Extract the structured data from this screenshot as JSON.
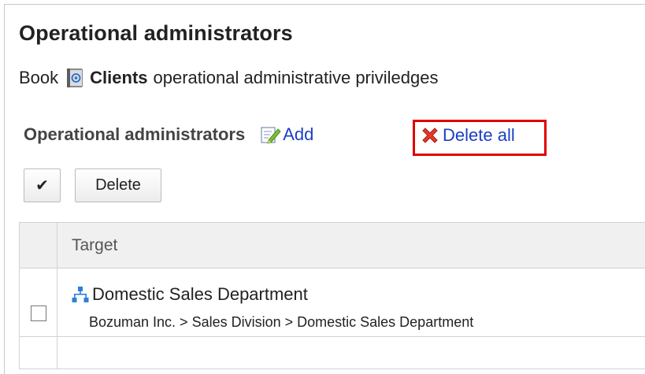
{
  "page": {
    "title": "Operational administrators",
    "subtitle_prefix": "Book",
    "subtitle_bold": "Clients",
    "subtitle_suffix": "operational administrative priviledges"
  },
  "section": {
    "title": "Operational administrators",
    "add_label": "Add",
    "delete_all_label": "Delete all"
  },
  "toolbar": {
    "check_label": "✔",
    "delete_label": "Delete"
  },
  "table": {
    "header_target": "Target",
    "rows": [
      {
        "name": "Domestic Sales Department",
        "path": "Bozuman Inc. > Sales Division > Domestic Sales Department"
      }
    ]
  },
  "colors": {
    "link": "#1a3fc4",
    "highlight": "#e00000",
    "header_bg": "#f0f0f0"
  },
  "icons": {
    "book": "book-icon",
    "add": "edit-pencil-icon",
    "delete_all": "red-x-icon",
    "org": "org-chart-icon"
  }
}
